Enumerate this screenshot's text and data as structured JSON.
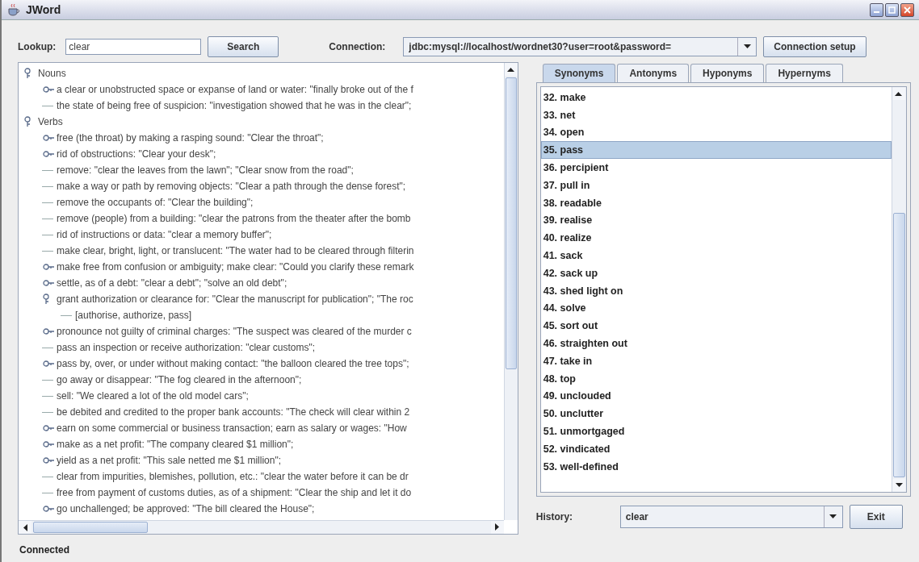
{
  "window": {
    "title": "JWord"
  },
  "toolbar": {
    "lookup_label": "Lookup:",
    "lookup_value": "clear",
    "search_button": "Search",
    "connection_label": "Connection:",
    "connection_value": "jdbc:mysql://localhost/wordnet30?user=root&password=",
    "setup_button": "Connection setup"
  },
  "tree": [
    {
      "text": "Nouns",
      "kind": "branch",
      "expanded": true,
      "children": [
        {
          "text": "a clear or unobstructed space or expanse of land or water: \"finally broke out of the f",
          "kind": "branch",
          "expanded": false
        },
        {
          "text": "the state of being free of suspicion: \"investigation showed that he was in the clear\";",
          "kind": "leaf"
        }
      ]
    },
    {
      "text": "Verbs",
      "kind": "branch",
      "expanded": true,
      "children": [
        {
          "text": "free (the throat) by making a rasping sound: \"Clear the throat\";",
          "kind": "branch",
          "expanded": false
        },
        {
          "text": "rid of obstructions: \"Clear your desk\";",
          "kind": "branch",
          "expanded": false
        },
        {
          "text": "remove: \"clear the leaves from the lawn\"; \"Clear snow from the road\";",
          "kind": "leaf"
        },
        {
          "text": "make a way or path by removing objects: \"Clear a path through the dense forest\";",
          "kind": "leaf"
        },
        {
          "text": "remove the occupants of: \"Clear the building\";",
          "kind": "leaf"
        },
        {
          "text": "remove (people) from a building: \"clear the patrons from the theater after the bomb",
          "kind": "leaf"
        },
        {
          "text": "rid of instructions or data: \"clear a memory buffer\";",
          "kind": "leaf"
        },
        {
          "text": "make clear, bright, light, or translucent: \"The water had to be cleared through filterin",
          "kind": "leaf"
        },
        {
          "text": "make free from confusion or ambiguity; make clear: \"Could you clarify these remark",
          "kind": "branch",
          "expanded": false
        },
        {
          "text": "settle, as of a debt: \"clear a debt\"; \"solve an old debt\";",
          "kind": "branch",
          "expanded": false
        },
        {
          "text": "grant authorization or clearance for: \"Clear the manuscript for publication\"; \"The roc",
          "kind": "branch",
          "expanded": true,
          "children": [
            {
              "text": "[authorise, authorize, pass]",
              "kind": "leaf"
            }
          ]
        },
        {
          "text": "pronounce not guilty of criminal charges: \"The suspect was cleared of the murder c",
          "kind": "branch",
          "expanded": false
        },
        {
          "text": "pass an inspection or receive authorization: \"clear customs\";",
          "kind": "leaf"
        },
        {
          "text": "pass by, over, or under without making contact: \"the balloon cleared the tree tops\";",
          "kind": "branch",
          "expanded": false
        },
        {
          "text": "go away or disappear: \"The fog cleared in the afternoon\";",
          "kind": "leaf"
        },
        {
          "text": "sell: \"We cleared a lot of the old model cars\";",
          "kind": "leaf"
        },
        {
          "text": "be debited and credited to the proper bank accounts: \"The check will clear within 2",
          "kind": "leaf"
        },
        {
          "text": "earn on some commercial or business transaction; earn as salary or wages: \"How",
          "kind": "branch",
          "expanded": false
        },
        {
          "text": "make as a net profit: \"The company cleared $1 million\";",
          "kind": "branch",
          "expanded": false
        },
        {
          "text": "yield as a net profit: \"This sale netted me $1 million\";",
          "kind": "branch",
          "expanded": false
        },
        {
          "text": "clear from impurities, blemishes, pollution, etc.: \"clear the water before it can be dr",
          "kind": "leaf"
        },
        {
          "text": "free from payment of customs duties, as of a shipment: \"Clear the ship and let it do",
          "kind": "leaf"
        },
        {
          "text": "go unchallenged; be approved: \"The bill cleared the House\";",
          "kind": "branch",
          "expanded": false
        }
      ]
    }
  ],
  "tabs": [
    {
      "label": "Synonyms",
      "selected": true
    },
    {
      "label": "Antonyms",
      "selected": false
    },
    {
      "label": "Hyponyms",
      "selected": false
    },
    {
      "label": "Hypernyms",
      "selected": false
    }
  ],
  "synonyms": [
    {
      "text": "32. make",
      "selected": false
    },
    {
      "text": "33. net",
      "selected": false
    },
    {
      "text": "34. open",
      "selected": false
    },
    {
      "text": "35. pass",
      "selected": true
    },
    {
      "text": "36. percipient",
      "selected": false
    },
    {
      "text": "37. pull in",
      "selected": false
    },
    {
      "text": "38. readable",
      "selected": false
    },
    {
      "text": "39. realise",
      "selected": false
    },
    {
      "text": "40. realize",
      "selected": false
    },
    {
      "text": "41. sack",
      "selected": false
    },
    {
      "text": "42. sack up",
      "selected": false
    },
    {
      "text": "43. shed light on",
      "selected": false
    },
    {
      "text": "44. solve",
      "selected": false
    },
    {
      "text": "45. sort out",
      "selected": false
    },
    {
      "text": "46. straighten out",
      "selected": false
    },
    {
      "text": "47. take in",
      "selected": false
    },
    {
      "text": "48. top",
      "selected": false
    },
    {
      "text": "49. unclouded",
      "selected": false
    },
    {
      "text": "50. unclutter",
      "selected": false
    },
    {
      "text": "51. unmortgaged",
      "selected": false
    },
    {
      "text": "52. vindicated",
      "selected": false
    },
    {
      "text": "53. well-defined",
      "selected": false
    }
  ],
  "history": {
    "label": "History:",
    "value": "clear",
    "exit_button": "Exit"
  },
  "status_bar": "Connected"
}
